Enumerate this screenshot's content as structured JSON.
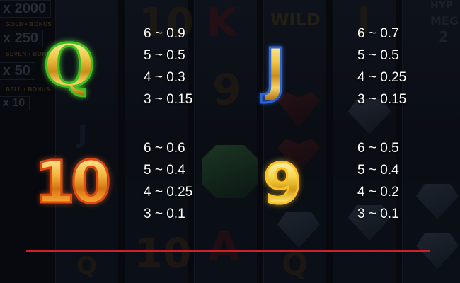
{
  "paytable": [
    {
      "symbol": "Q",
      "icon": "queen-symbol-icon",
      "pays": [
        "6 ~ 0.9",
        "5 ~ 0.5",
        "4 ~ 0.3",
        "3 ~ 0.15"
      ]
    },
    {
      "symbol": "J",
      "icon": "jack-symbol-icon",
      "pays": [
        "6 ~ 0.7",
        "5 ~ 0.5",
        "4 ~ 0.25",
        "3 ~ 0.15"
      ]
    },
    {
      "symbol": "10",
      "icon": "ten-symbol-icon",
      "pays": [
        "6 ~ 0.6",
        "5 ~ 0.4",
        "4 ~ 0.25",
        "3 ~ 0.1"
      ]
    },
    {
      "symbol": "9",
      "icon": "nine-symbol-icon",
      "pays": [
        "6 ~ 0.5",
        "5 ~ 0.4",
        "4 ~ 0.2",
        "3 ~ 0.1"
      ]
    }
  ],
  "background": {
    "side_panel": [
      "x 2000",
      "x 250",
      "x 50",
      "x 10"
    ],
    "side_tags": [
      "GOLD • BONUS",
      "SEVEN • BONUS",
      "BELL • BONUS"
    ],
    "reel_ghosts": [
      "10",
      "K",
      "WILD",
      "J",
      "9",
      "10",
      "A",
      "Q",
      "J",
      "Q"
    ],
    "right_panel": [
      "HYP",
      "MEG",
      "2"
    ]
  },
  "colors": {
    "q_glow": "#3cc21a",
    "j_glow": "#2a64d8",
    "ten_glow": "#e04810",
    "nine_glow": "#ffbf20",
    "divider": "#d2202a"
  }
}
